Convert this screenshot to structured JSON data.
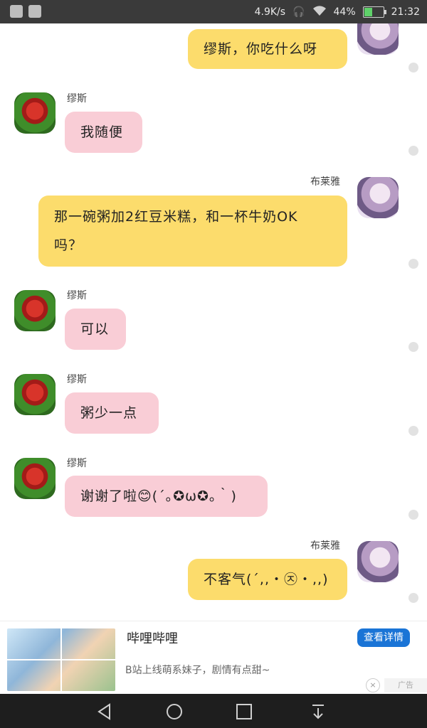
{
  "status_bar": {
    "speed": "4.9K/s",
    "battery_percent": "44%",
    "time": "21:32",
    "battery_level": 0.44
  },
  "messages": [
    {
      "id": "m1",
      "side": "self",
      "sender": "",
      "text": "缪斯，你吃什么呀"
    },
    {
      "id": "m2",
      "side": "other",
      "sender": "缪斯",
      "text": "我随便"
    },
    {
      "id": "m3",
      "side": "self",
      "sender": "布莱雅",
      "text_line1": "那一碗粥加2红豆米糕，和一杯牛奶OK",
      "text_line2": "吗？"
    },
    {
      "id": "m4",
      "side": "other",
      "sender": "缪斯",
      "text": "可以"
    },
    {
      "id": "m5",
      "side": "other",
      "sender": "缪斯",
      "text": "粥少一点"
    },
    {
      "id": "m6",
      "side": "other",
      "sender": "缪斯",
      "text": "谢谢了啦😊(´｡✪ω✪｡｀)"
    },
    {
      "id": "m7",
      "side": "self",
      "sender": "布莱雅",
      "text": "不客气(´,,・㉨・,,)"
    }
  ],
  "ad": {
    "title": "哔哩哔哩",
    "description": "B站上线萌系妹子，剧情有点甜~",
    "button_label": "查看详情",
    "close_label": "×",
    "tag": "广告"
  },
  "icons": {
    "back": "back-triangle-icon",
    "home": "home-circle-icon",
    "recent": "recent-square-icon",
    "down": "hide-keyboard-icon"
  }
}
